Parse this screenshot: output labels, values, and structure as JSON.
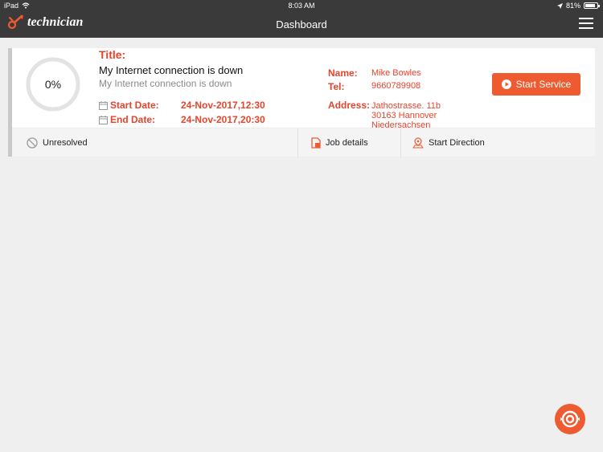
{
  "status_bar": {
    "device": "iPad",
    "time": "8:03 AM",
    "battery": "81%"
  },
  "nav": {
    "brand": "technician",
    "title": "Dashboard"
  },
  "job": {
    "progress_label": "0%",
    "progress_fraction": 0,
    "title_label": "Title:",
    "title": "My Internet connection is down",
    "subtitle": "My Internet connection is down",
    "start_label": "Start Date:",
    "start_value": "24-Nov-2017,12:30",
    "end_label": "End Date:",
    "end_value": "24-Nov-2017,20:30",
    "name_label": "Name:",
    "name_value": "Mike Bowles",
    "tel_label": "Tel:",
    "tel_value": "9660789908",
    "address_label": "Address:",
    "address_lines": [
      "Jathostrasse. 11b",
      "30163 Hannover",
      "Niedersachsen"
    ],
    "start_service_label": "Start Service"
  },
  "footer": {
    "status_label": "Unresolved",
    "job_details_label": "Job details",
    "direction_label": "Start Direction"
  },
  "colors": {
    "accent": "#ef5b30",
    "label_red": "#e8432b",
    "bar": "#3a3a3a"
  },
  "icons": [
    "wifi-icon",
    "location-arrow-icon",
    "battery-icon",
    "technician-logo-icon",
    "menu-icon",
    "calendar-icon",
    "play-icon",
    "no-entry-icon",
    "document-icon",
    "map-pin-icon",
    "sync-icon"
  ]
}
